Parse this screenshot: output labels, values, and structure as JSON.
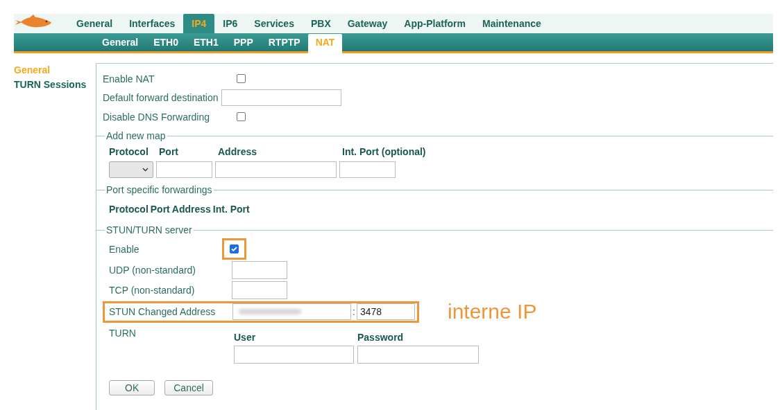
{
  "main_tabs": [
    {
      "label": "General",
      "selected": false
    },
    {
      "label": "Interfaces",
      "selected": false
    },
    {
      "label": "IP4",
      "selected": true
    },
    {
      "label": "IP6",
      "selected": false
    },
    {
      "label": "Services",
      "selected": false
    },
    {
      "label": "PBX",
      "selected": false
    },
    {
      "label": "Gateway",
      "selected": false
    },
    {
      "label": "App-Platform",
      "selected": false
    },
    {
      "label": "Maintenance",
      "selected": false
    }
  ],
  "sub_tabs": [
    {
      "label": "General",
      "selected": false
    },
    {
      "label": "ETH0",
      "selected": false
    },
    {
      "label": "ETH1",
      "selected": false
    },
    {
      "label": "PPP",
      "selected": false
    },
    {
      "label": "RTPTP",
      "selected": false
    },
    {
      "label": "NAT",
      "selected": true
    }
  ],
  "sidebar": {
    "items": [
      {
        "label": "General",
        "selected": true
      },
      {
        "label": "TURN Sessions",
        "selected": false
      }
    ]
  },
  "settings": [
    {
      "kind": "checkbox",
      "label": "Enable NAT",
      "checked": false
    },
    {
      "kind": "text",
      "label": "Default forward destination"
    },
    {
      "kind": "checkbox",
      "label": "Disable DNS Forwarding",
      "checked": false
    }
  ],
  "add_new_map": {
    "title": "Add new map",
    "columns": [
      "Protocol",
      "Port",
      "Address",
      "Int. Port (optional)"
    ]
  },
  "port_forwardings": {
    "title": "Port specific forwardings",
    "columns": [
      "Protocol",
      "Port",
      "Address",
      "Int. Port"
    ]
  },
  "stun_turn": {
    "title": "STUN/TURN server",
    "enable": {
      "label": "Enable",
      "checked": true,
      "highlighted": true
    },
    "udp": {
      "label": "UDP (non-standard)"
    },
    "tcp": {
      "label": "TCP (non-standard)"
    },
    "changed_address": {
      "label": "STUN Changed Address",
      "separator": ":",
      "port": "3478",
      "highlighted": true
    },
    "turn": {
      "label": "TURN",
      "user_label": "User",
      "password_label": "Password"
    }
  },
  "buttons": [
    "OK",
    "Cancel"
  ],
  "annotation": {
    "label": "interne IP"
  }
}
